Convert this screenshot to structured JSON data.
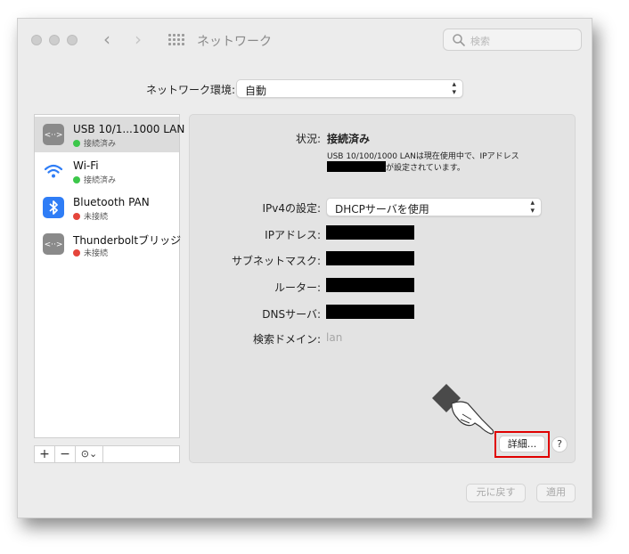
{
  "window": {
    "title": "ネットワーク",
    "search_placeholder": "検索"
  },
  "location": {
    "label": "ネットワーク環境:",
    "value": "自動"
  },
  "services": [
    {
      "name": "USB 10/1...1000 LAN",
      "status": "接続済み",
      "status_color": "#3cc74a",
      "icon": "ethernet-icon"
    },
    {
      "name": "Wi-Fi",
      "status": "接続済み",
      "status_color": "#3cc74a",
      "icon": "wifi-icon"
    },
    {
      "name": "Bluetooth PAN",
      "status": "未接続",
      "status_color": "#e5453b",
      "icon": "bluetooth-icon"
    },
    {
      "name": "Thunderboltブリッジ",
      "status": "未接続",
      "status_color": "#e5453b",
      "icon": "bridge-icon"
    }
  ],
  "sidebar_tools": {
    "add": "+",
    "remove": "−",
    "action": "⊙⌄"
  },
  "detail": {
    "status_label": "状況:",
    "status_value": "接続済み",
    "status_desc_line1": "USB 10/100/1000 LANは現在使用中で、IPアドレス",
    "status_desc_line2": "が設定されています。",
    "ipv4_label": "IPv4の設定:",
    "ipv4_value": "DHCPサーバを使用",
    "ip_label": "IPアドレス:",
    "subnet_label": "サブネットマスク:",
    "router_label": "ルーター:",
    "dns_label": "DNSサーバ:",
    "search_domain_label": "検索ドメイン:",
    "search_domain_value": "lan",
    "advanced_button": "詳細...",
    "help_button": "?"
  },
  "footer": {
    "revert": "元に戻す",
    "apply": "適用"
  },
  "colors": {
    "highlight": "#e00000",
    "connected": "#3cc74a",
    "disconnected": "#e5453b",
    "bluetooth": "#2f7df6"
  }
}
